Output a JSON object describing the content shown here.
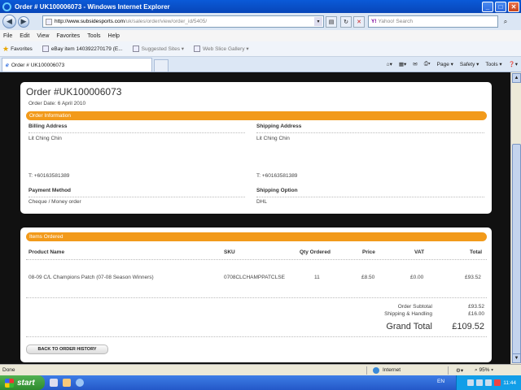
{
  "window": {
    "title": "Order # UK100006073 - Windows Internet Explorer",
    "minimize": "_",
    "maximize": "□",
    "close": "✕"
  },
  "address_bar": {
    "domain": "http://www.subsidesports.com",
    "path": "/uk/sales/order/view/order_id/5405/",
    "search_placeholder": "Yahoo! Search",
    "search_logo": "Y!"
  },
  "menu": [
    "File",
    "Edit",
    "View",
    "Favorites",
    "Tools",
    "Help"
  ],
  "favorites_bar": {
    "favorites_label": "Favorites",
    "items": [
      "eBay item 140392270179 (E...",
      "Suggested Sites ▾",
      "Web Slice Gallery ▾"
    ]
  },
  "tab": {
    "label": "Order # UK100006073"
  },
  "command_bar": [
    "Page ▾",
    "Safety ▾",
    "Tools ▾",
    "❓▾"
  ],
  "order": {
    "title": "Order #UK100006073",
    "date": "Order Date: 6 April 2010",
    "info_header": "Order Information",
    "billing_label": "Billing Address",
    "billing_name": "Lit Ching Chin",
    "billing_phone": "T: +60163581389",
    "shipping_label": "Shipping Address",
    "shipping_name": "Lit Ching Chin",
    "shipping_phone": "T: +60163581389",
    "payment_label": "Payment Method",
    "payment_value": "Cheque / Money order",
    "shipping_option_label": "Shipping Option",
    "shipping_option_value": "DHL"
  },
  "items": {
    "header": "Items Ordered",
    "columns": [
      "Product Name",
      "SKU",
      "Qty Ordered",
      "Price",
      "VAT",
      "Total"
    ],
    "rows": [
      [
        "08-09 C/L Champions Patch (07-08 Season Winners)",
        "0708CLCHAMPPATCLSE",
        "11",
        "£8.50",
        "£0.00",
        "£93.52"
      ]
    ],
    "subtotal_label": "Order Subtotal",
    "subtotal_value": "£93.52",
    "shipping_label": "Shipping & Handling",
    "shipping_value": "£16.00",
    "grand_total_label": "Grand Total",
    "grand_total_value": "£109.52",
    "back_button": "BACK TO ORDER HISTORY"
  },
  "status_bar": {
    "left": "Done",
    "zone": "Internet",
    "zoom": "95%"
  },
  "taskbar": {
    "start": "start",
    "language": "EN",
    "clock": "11:44"
  },
  "colors": {
    "accent_orange": "#f29a1a",
    "page_background": "#111111",
    "titlebar_blue": "#0a5ad8",
    "taskbar_blue": "#2458c8",
    "start_green": "#3a9a3a"
  }
}
